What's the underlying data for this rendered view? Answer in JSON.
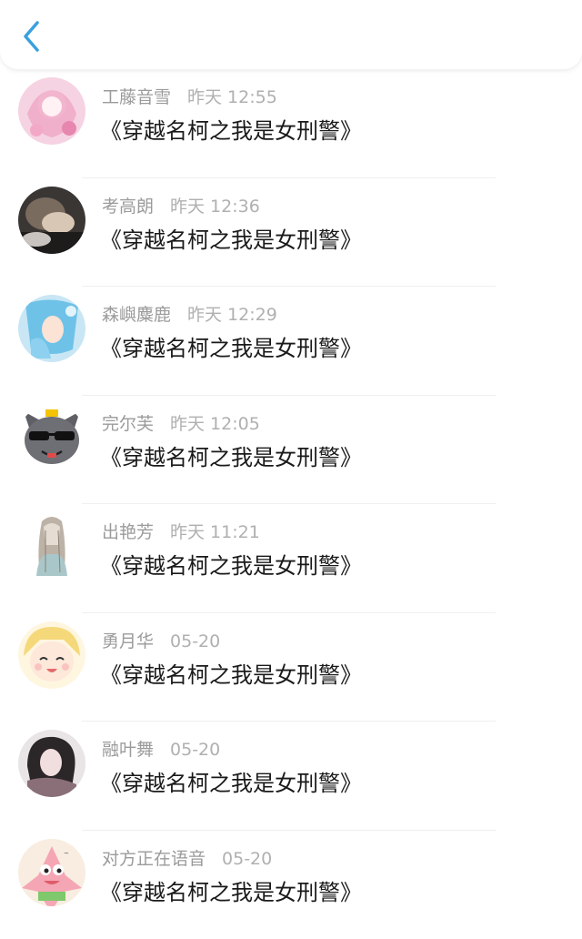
{
  "header": {
    "back_icon": "chevron-left-icon",
    "accent": "#3aa0e0"
  },
  "messages": [
    {
      "name": "工藤音雪",
      "time": "昨天 12:55",
      "text": "《穿越名柯之我是女刑警》",
      "avatar": "anime-pink-girl"
    },
    {
      "name": "考高朗",
      "time": "昨天 12:36",
      "text": "《穿越名柯之我是女刑警》",
      "avatar": "sleeping-man"
    },
    {
      "name": "森嶼麋鹿",
      "time": "昨天 12:29",
      "text": "《穿越名柯之我是女刑警》",
      "avatar": "anime-blue-hair"
    },
    {
      "name": "完尔芙",
      "time": "昨天 12:05",
      "text": "《穿越名柯之我是女刑警》",
      "avatar": "wolf-sunglasses"
    },
    {
      "name": "出艳芳",
      "time": "昨天 11:21",
      "text": "《穿越名柯之我是女刑警》",
      "avatar": "sketch-girl"
    },
    {
      "name": "勇月华",
      "time": "05-20",
      "text": "《穿越名柯之我是女刑警》",
      "avatar": "anime-blonde-smile"
    },
    {
      "name": "融叶舞",
      "time": "05-20",
      "text": "《穿越名柯之我是女刑警》",
      "avatar": "dark-hair-girl"
    },
    {
      "name": "对方正在语音",
      "time": "05-20",
      "text": "《穿越名柯之我是女刑警》",
      "avatar": "patrick-star"
    }
  ]
}
